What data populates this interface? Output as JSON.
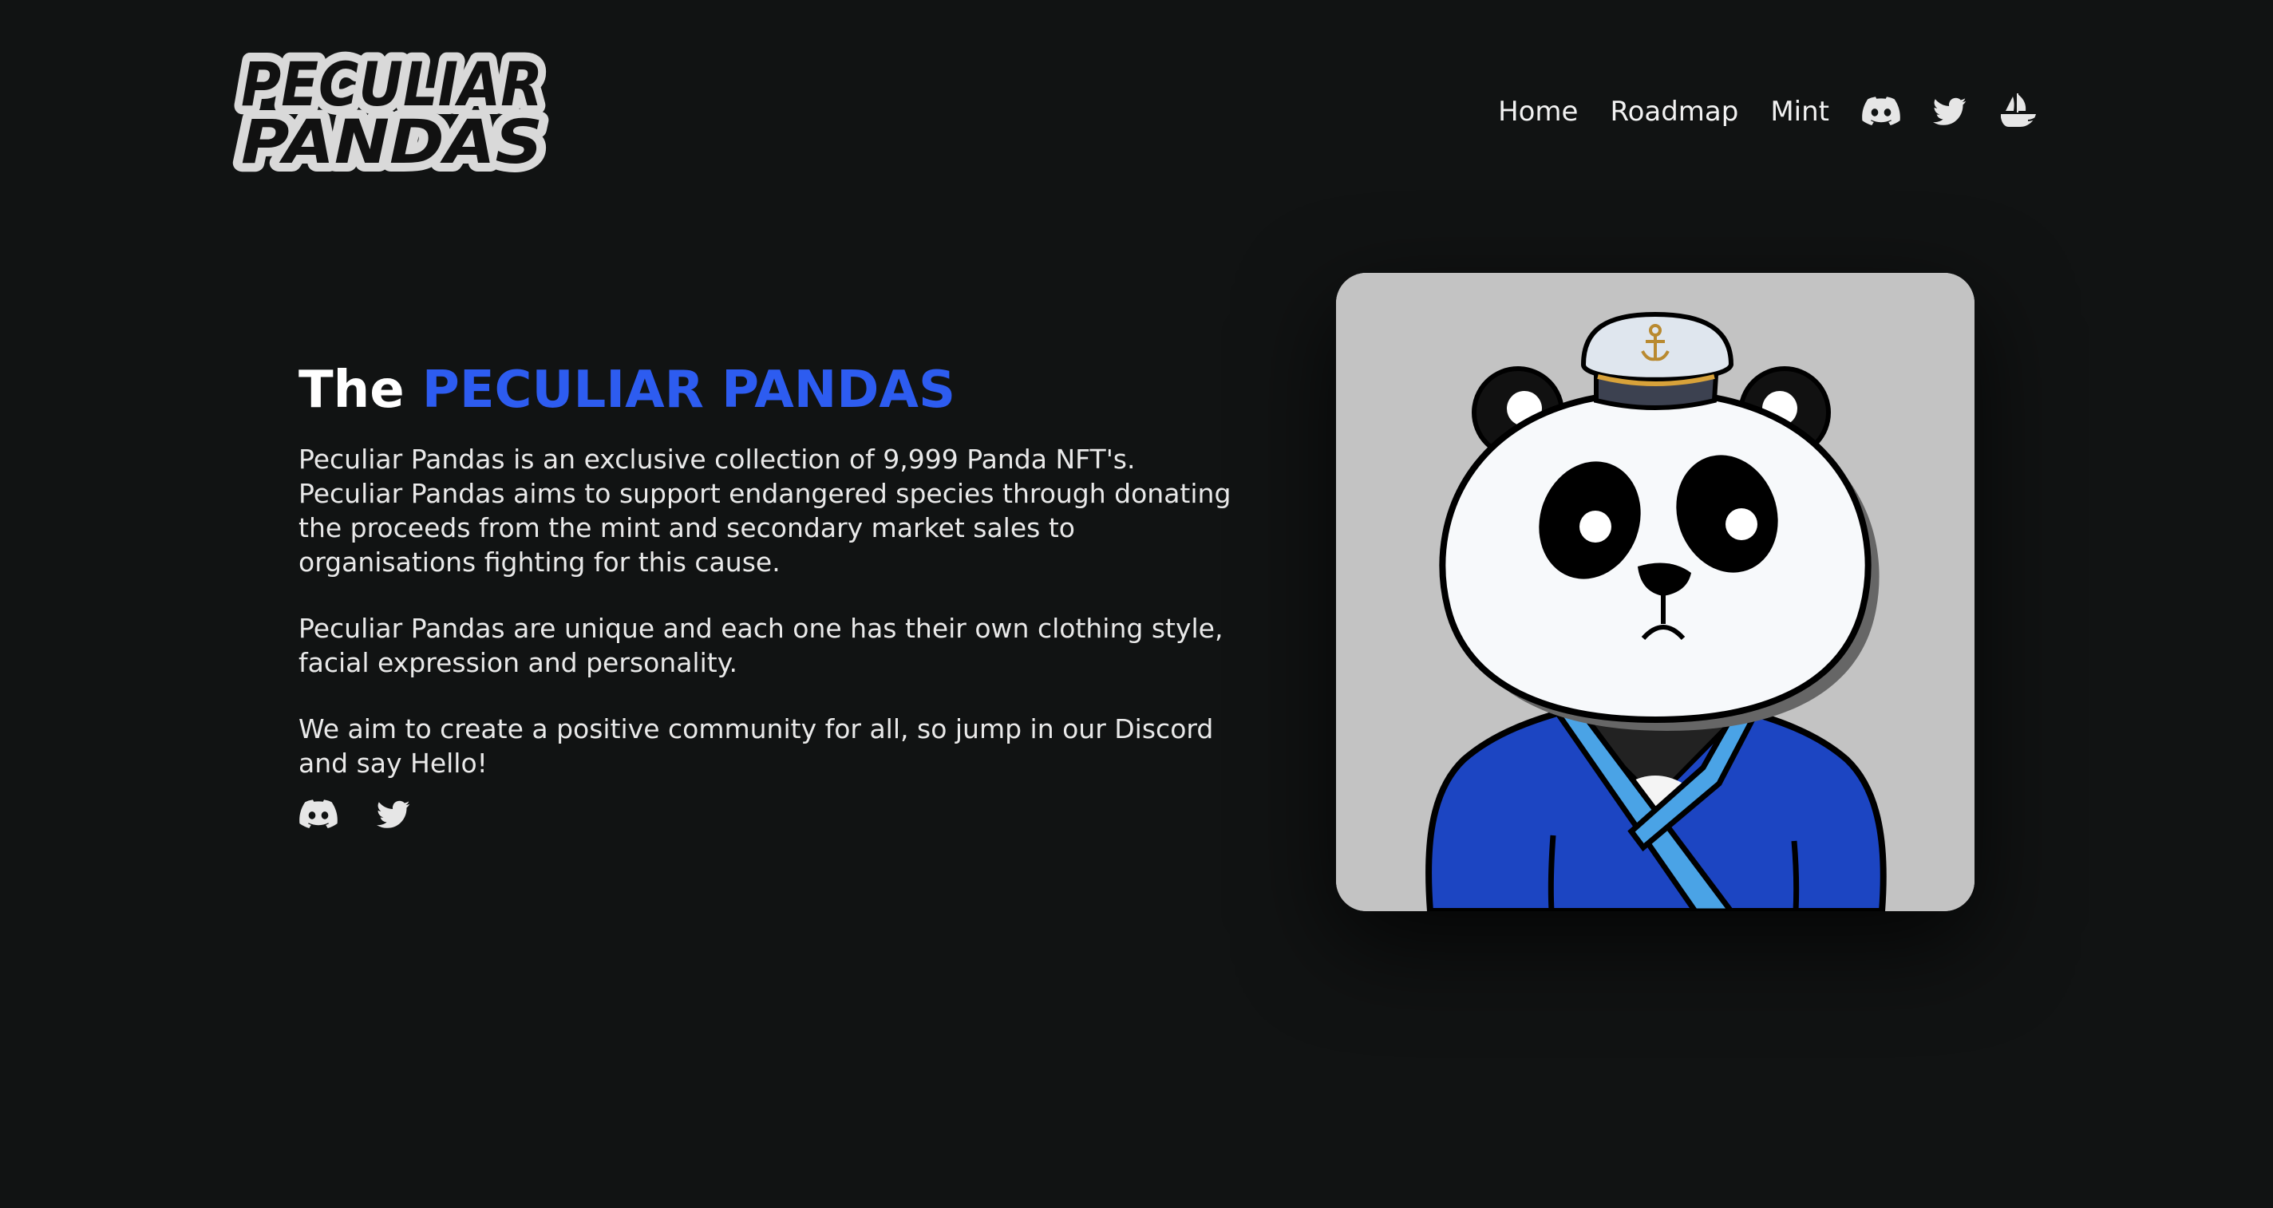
{
  "brand": {
    "logo_line1": "PECULIAR",
    "logo_line2": "PANDAS"
  },
  "nav": {
    "items": [
      "Home",
      "Roadmap",
      "Mint"
    ],
    "icons": [
      "discord-icon",
      "twitter-icon",
      "opensea-icon"
    ]
  },
  "hero": {
    "title_prefix": "The",
    "title_accent": "PECULIAR PANDAS",
    "paragraphs": [
      "Peculiar Pandas is an exclusive collection of 9,999 Panda NFT's. Peculiar Pandas aims to support endangered species through donating the proceeds from the mint and secondary market sales to organisations fighting for this cause.",
      "Peculiar Pandas are unique and each one has their own clothing style, facial expression and personality.",
      "We aim to create a positive community for all, so jump in our Discord and say Hello!"
    ],
    "social_icons": [
      "discord-icon",
      "twitter-icon"
    ]
  },
  "colors": {
    "background": "#111313",
    "accent": "#2d5cf0",
    "text": "#e9e9e9",
    "card_bg": "#c3c3c3"
  }
}
